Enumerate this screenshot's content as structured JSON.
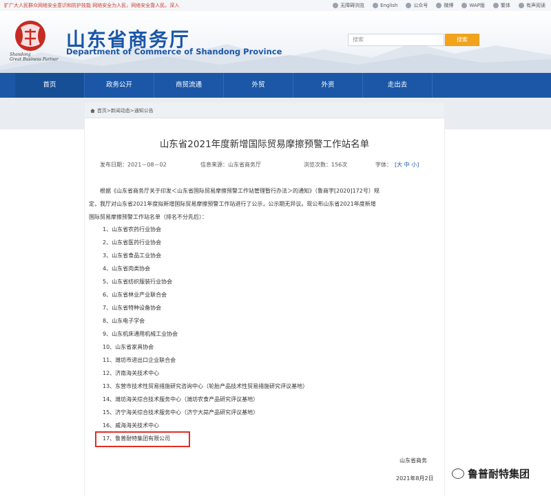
{
  "topbar": {
    "ticker": "犷广大人民群众网络安全意识和防护技能 网络安全为人民，网络安全靠人民。深入",
    "links": [
      "无障碍浏览",
      "English",
      "公众号",
      "微博",
      "WAP版",
      "繁体",
      "有声阅读"
    ],
    "icons": [
      "accessibility-icon",
      "english-icon",
      "wechat-icon",
      "weibo-icon",
      "wap-icon",
      "traditional-icon",
      "audio-icon"
    ]
  },
  "header": {
    "title_cn": "山东省商务厅",
    "title_en": "Department of Commerce of Shandong Province",
    "seal_line1": "Shandong",
    "seal_line2": "Great Business Partner",
    "search_placeholder": "搜索",
    "search_button": "搜索"
  },
  "nav": [
    "首页",
    "政务公开",
    "商贸流通",
    "外贸",
    "外资",
    "走出去"
  ],
  "breadcrumb": "首页>新闻动态>通知公告",
  "article": {
    "title": "山东省2021年度新增国际贸易摩擦预警工作站名单",
    "date_label": "发布日期：2021－08－02",
    "source_label": "信息来源：山东省商务厅",
    "views_label": "浏览次数：156次",
    "fontsize_label": "字体：",
    "fontsize_options": "[大 中 小]",
    "para_line1": "根据《山东省商务厅关于印发＜山东省国际贸易摩擦预警工作站管理暂行办法＞的通知》（鲁商字[2020]172号）规",
    "para_line2": "定，我厅对山东省2021年度拟新增国际贸易摩擦预警工作站进行了公示，公示期无异议。现公布山东省2021年度新增",
    "para_line3": "国际贸易摩擦预警工作站名单（排名不分先后）：",
    "items": [
      "1、山东省农药行业协会",
      "2、山东省医药行业协会",
      "3、山东省食品工业协会",
      "4、山东省肉类协会",
      "5、山东省纺织服装行业协会",
      "6、山东省林业产业联合会",
      "7、山东省特种设备协会",
      "8、山东电子学会",
      "9、山东机床通用机械工业协会",
      "10、山东省家具协会",
      "11、潍坊市进出口企业联合会",
      "12、济南海关技术中心",
      "13、东营市技术性贸易措施研究咨询中心（轮胎产品技术性贸易措施研究评议基地）",
      "14、潍坊海关综合技术服务中心（潍坊农食产品研究评议基地）",
      "15、济宁海关综合技术服务中心（济宁大蒜产品研究评议基地）",
      "16、威海海关技术中心",
      "17、鲁普耐特集团有限公司"
    ],
    "sign_org": "山东省商务",
    "sign_date": "2021年8月2日"
  },
  "watermark": "鲁普耐特集团",
  "colors": {
    "brand_blue": "#1b57a6",
    "highlight_red": "#e52b22",
    "search_orange": "#f2a21b"
  }
}
